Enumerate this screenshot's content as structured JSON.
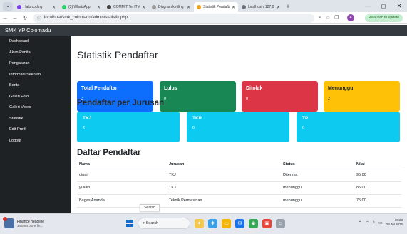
{
  "browser": {
    "tabs": [
      {
        "title": "Halo coding",
        "active": false,
        "color": "#7c3aed"
      },
      {
        "title": "(3) WhatsApp",
        "active": false,
        "color": "#25d366"
      },
      {
        "title": "COMMIT Tel ITM",
        "active": false,
        "color": "#444444"
      },
      {
        "title": "Diagram keliling",
        "active": false,
        "color": "#999999"
      },
      {
        "title": "Statistik Pendaftar",
        "active": true,
        "color": "#f4a020"
      },
      {
        "title": "localhost / 127.0.0.1",
        "active": false,
        "color": "#6c757d"
      }
    ],
    "url": "localhost/smk_colomadu/admin/statistik.php",
    "relaunch_label": "Relaunch to update",
    "profile_initial": "A"
  },
  "app": {
    "brand": "SMK YP Colomadu",
    "sidebar": [
      "Dashboard",
      "Akun Panita",
      "Pengaturan",
      "Informasi Sekolah",
      "Berita",
      "Galeri Foto",
      "Galeri Video",
      "Statistik",
      "Edit Profil",
      "Logout"
    ]
  },
  "main": {
    "title": "Statistik Pendaftar",
    "stats": [
      {
        "label": "Total Pendaftar",
        "value": "3",
        "color": "#0d6efd"
      },
      {
        "label": "Lulus",
        "value": "0",
        "color": "#198754"
      },
      {
        "label": "Ditolak",
        "value": "0",
        "color": "#dc3545"
      },
      {
        "label": "Menunggu",
        "value": "2",
        "color": "#ffc107"
      }
    ],
    "jurusan_title": "Pendaftar per Jurusan",
    "jurusan": [
      {
        "label": "TKJ",
        "value": "2"
      },
      {
        "label": "TKR",
        "value": "0"
      },
      {
        "label": "TP",
        "value": "0"
      }
    ],
    "daftar_title": "Daftar Pendaftar",
    "table": {
      "headers": [
        "Nama",
        "Jurusan",
        "Status",
        "Nilai"
      ],
      "rows": [
        [
          "dipai",
          "TKJ",
          "Diterima",
          "95.00"
        ],
        [
          "yuliaku",
          "TKJ",
          "menunggu",
          "85.00"
        ],
        [
          "Bagas Ananda",
          "Teknik Permesinan",
          "menunggu",
          "75.00"
        ]
      ]
    }
  },
  "tooltip": "Search",
  "taskbar": {
    "news_title": "Finance headline",
    "news_sub": "Japan's June fin...",
    "search_placeholder": "Search",
    "time": "10:23",
    "date": "28 Jul 2025"
  }
}
